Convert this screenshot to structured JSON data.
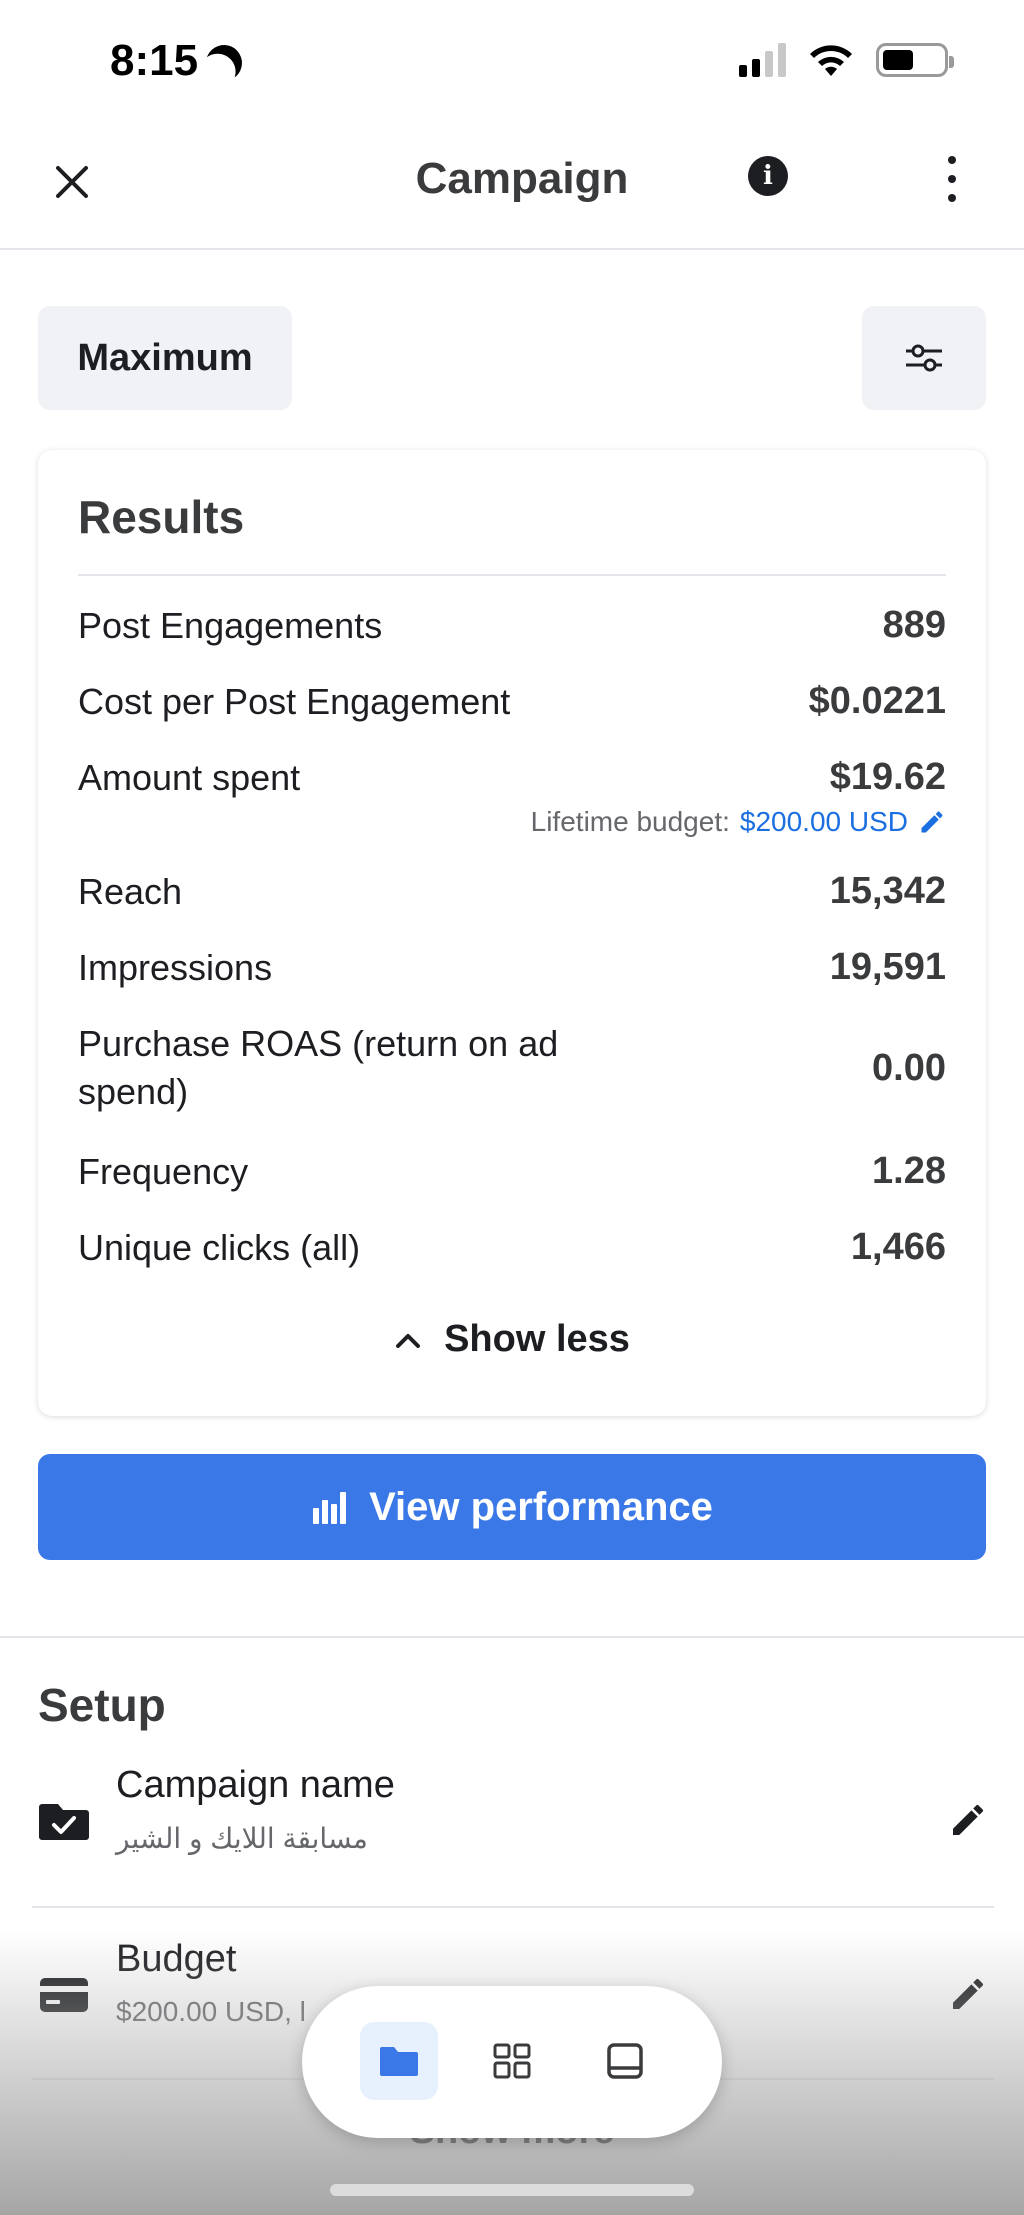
{
  "status_bar": {
    "time": "8:15"
  },
  "header": {
    "title": "Campaign"
  },
  "filter": {
    "label": "Maximum"
  },
  "results": {
    "title": "Results",
    "metrics": [
      {
        "label": "Post Engagements",
        "value": "889"
      },
      {
        "label": "Cost per Post Engagement",
        "value": "$0.0221"
      },
      {
        "label": "Amount spent",
        "value": "$19.62"
      },
      {
        "label": "Reach",
        "value": "15,342"
      },
      {
        "label": "Impressions",
        "value": "19,591"
      },
      {
        "label": "Purchase ROAS (return on ad spend)",
        "value": "0.00"
      },
      {
        "label": "Frequency",
        "value": "1.28"
      },
      {
        "label": "Unique clicks (all)",
        "value": "1,466"
      }
    ],
    "budget_prefix": "Lifetime budget:",
    "budget_value": "$200.00 USD",
    "show_less": "Show less"
  },
  "view_performance": {
    "label": "View performance"
  },
  "setup": {
    "title": "Setup",
    "campaign_name": {
      "label": "Campaign name",
      "value": "مسابقة اللايك و الشير"
    },
    "budget": {
      "label": "Budget",
      "value": "$200.00 USD, l"
    },
    "show_more": "Show more"
  },
  "colors": {
    "accent": "#3b78e7",
    "link": "#1b6fe0",
    "text": "#1c1e21",
    "muted": "#65676b"
  },
  "icons": [
    "close-icon",
    "info-icon",
    "more-icon",
    "sliders-icon",
    "bar-chart-icon",
    "chevron-up-icon",
    "folder-check-icon",
    "credit-card-icon",
    "pencil-icon",
    "folder-icon",
    "grid-icon",
    "tablet-icon"
  ]
}
